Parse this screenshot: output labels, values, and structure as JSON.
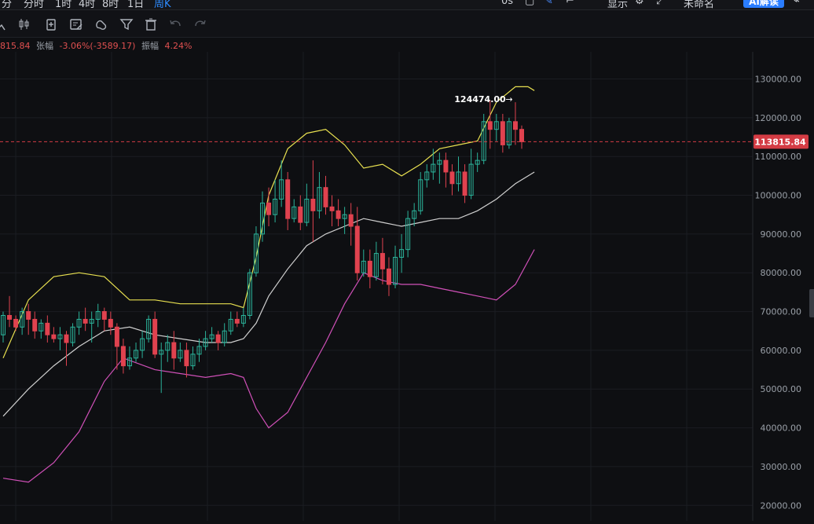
{
  "topbar": {
    "timeframes": [
      {
        "label": "分",
        "key": "min"
      },
      {
        "label": "分时",
        "key": "time"
      },
      {
        "label": "1时",
        "key": "1h"
      },
      {
        "label": "4时",
        "key": "4h"
      },
      {
        "label": "8时",
        "key": "8h"
      },
      {
        "label": "1日",
        "key": "1d"
      },
      {
        "label": "周K",
        "key": "1w",
        "active": true
      }
    ],
    "right_items": [
      "0s",
      "显示",
      "未命名"
    ],
    "ai_button": "AI解读"
  },
  "infoline": {
    "close_fragment": "815.84",
    "change_label": "张幅",
    "change_value": "-3.06%(-3589.17)",
    "amplitude_label": "振幅",
    "amplitude_value": "4.24%"
  },
  "colors": {
    "up": "#2bb39a",
    "down": "#e0424f",
    "upper_band": "#e8e050",
    "middle_band": "#d0d0d0",
    "lower_band": "#d050b8",
    "price_tag": "#d43c44"
  },
  "chart_data": {
    "type": "candlestick",
    "y_axis": {
      "ticks": [
        "130000.00",
        "120000.00",
        "110000.00",
        "100000.00",
        "90000.00",
        "80000.00",
        "70000.00",
        "60000.00",
        "50000.00",
        "40000.00",
        "30000.00",
        "20000.00"
      ],
      "ylim": [
        16000,
        137000
      ]
    },
    "last_price": "113815.84",
    "high_marker": "124474.00",
    "candles": [
      [
        64000,
        69000,
        62000,
        70000
      ],
      [
        69000,
        68000,
        66000,
        74000
      ],
      [
        68000,
        66000,
        65000,
        69000
      ],
      [
        66000,
        70000,
        64000,
        71000
      ],
      [
        70000,
        68000,
        64000,
        72000
      ],
      [
        68000,
        65000,
        63000,
        70000
      ],
      [
        65000,
        67000,
        63000,
        68000
      ],
      [
        67000,
        64000,
        62000,
        69000
      ],
      [
        64000,
        63000,
        62000,
        66000
      ],
      [
        63000,
        64000,
        60000,
        66000
      ],
      [
        64000,
        62000,
        56000,
        65000
      ],
      [
        62000,
        66000,
        61000,
        67000
      ],
      [
        66000,
        68000,
        64000,
        70000
      ],
      [
        68000,
        67000,
        65000,
        71000
      ],
      [
        67000,
        68000,
        62000,
        70000
      ],
      [
        68000,
        70000,
        66000,
        72000
      ],
      [
        70000,
        68000,
        65000,
        71000
      ],
      [
        68000,
        66000,
        64000,
        70000
      ],
      [
        66000,
        61000,
        55000,
        67000
      ],
      [
        61000,
        56000,
        54000,
        63000
      ],
      [
        56000,
        58000,
        55000,
        61000
      ],
      [
        58000,
        60000,
        57000,
        62000
      ],
      [
        60000,
        63000,
        58000,
        65000
      ],
      [
        63000,
        68000,
        62000,
        69000
      ],
      [
        68000,
        59000,
        58000,
        70000
      ],
      [
        59000,
        60000,
        49000,
        62000
      ],
      [
        60000,
        62000,
        57000,
        64000
      ],
      [
        62000,
        58000,
        55000,
        65000
      ],
      [
        58000,
        60000,
        57000,
        62000
      ],
      [
        60000,
        56000,
        53000,
        62000
      ],
      [
        56000,
        59000,
        55000,
        61000
      ],
      [
        59000,
        61000,
        57000,
        63000
      ],
      [
        61000,
        63000,
        60000,
        65000
      ],
      [
        63000,
        64000,
        62000,
        66000
      ],
      [
        64000,
        62000,
        60000,
        65000
      ],
      [
        62000,
        65000,
        61000,
        67000
      ],
      [
        65000,
        68000,
        64000,
        70000
      ],
      [
        68000,
        67000,
        66000,
        70000
      ],
      [
        67000,
        69000,
        66000,
        71000
      ],
      [
        69000,
        80000,
        68000,
        81000
      ],
      [
        80000,
        90000,
        79000,
        92000
      ],
      [
        90000,
        98000,
        88000,
        101000
      ],
      [
        98000,
        95000,
        92000,
        102000
      ],
      [
        95000,
        99000,
        93000,
        104000
      ],
      [
        99000,
        104000,
        97000,
        109000
      ],
      [
        104000,
        94000,
        91000,
        106000
      ],
      [
        94000,
        97000,
        93000,
        99000
      ],
      [
        97000,
        93000,
        91000,
        100000
      ],
      [
        93000,
        99000,
        92000,
        103000
      ],
      [
        99000,
        96000,
        88000,
        109000
      ],
      [
        96000,
        102000,
        94000,
        106000
      ],
      [
        102000,
        97000,
        95000,
        105000
      ],
      [
        97000,
        96000,
        92000,
        100000
      ],
      [
        96000,
        94000,
        92000,
        99000
      ],
      [
        94000,
        95000,
        90000,
        97000
      ],
      [
        95000,
        92000,
        87000,
        98000
      ],
      [
        92000,
        80000,
        78000,
        97000
      ],
      [
        80000,
        83000,
        79000,
        86000
      ],
      [
        83000,
        79000,
        76000,
        86000
      ],
      [
        79000,
        85000,
        78000,
        88000
      ],
      [
        85000,
        81000,
        77000,
        89000
      ],
      [
        81000,
        77000,
        74000,
        84000
      ],
      [
        77000,
        84000,
        76000,
        87000
      ],
      [
        84000,
        86000,
        80000,
        90000
      ],
      [
        86000,
        94000,
        84000,
        96000
      ],
      [
        94000,
        96000,
        92000,
        98000
      ],
      [
        96000,
        104000,
        95000,
        106000
      ],
      [
        104000,
        106000,
        102000,
        108000
      ],
      [
        106000,
        108000,
        104000,
        112000
      ],
      [
        108000,
        109000,
        103000,
        111000
      ],
      [
        109000,
        106000,
        102000,
        111000
      ],
      [
        106000,
        103000,
        100000,
        108000
      ],
      [
        103000,
        106000,
        101000,
        110000
      ],
      [
        106000,
        100000,
        98000,
        108000
      ],
      [
        100000,
        108000,
        99000,
        112000
      ],
      [
        108000,
        109000,
        106000,
        111000
      ],
      [
        109000,
        119000,
        108000,
        121000
      ],
      [
        119000,
        117000,
        112000,
        124474
      ],
      [
        117000,
        119000,
        114000,
        121000
      ],
      [
        119000,
        113000,
        111000,
        121000
      ],
      [
        113000,
        119000,
        112000,
        120000
      ],
      [
        119000,
        117000,
        113000,
        124000
      ],
      [
        117000,
        113816,
        112000,
        118000
      ]
    ],
    "upper_band": [
      [
        0,
        58000
      ],
      [
        4,
        73000
      ],
      [
        8,
        79000
      ],
      [
        12,
        80000
      ],
      [
        16,
        79000
      ],
      [
        20,
        73000
      ],
      [
        24,
        73000
      ],
      [
        28,
        72000
      ],
      [
        32,
        72000
      ],
      [
        36,
        72000
      ],
      [
        38,
        71000
      ],
      [
        40,
        84000
      ],
      [
        42,
        100000
      ],
      [
        45,
        112000
      ],
      [
        48,
        116000
      ],
      [
        51,
        117000
      ],
      [
        54,
        113000
      ],
      [
        57,
        107000
      ],
      [
        60,
        108000
      ],
      [
        63,
        105000
      ],
      [
        66,
        108000
      ],
      [
        69,
        112000
      ],
      [
        72,
        113000
      ],
      [
        75,
        114000
      ],
      [
        78,
        124000
      ],
      [
        81,
        128000
      ],
      [
        83,
        128000
      ],
      [
        84,
        127000
      ]
    ],
    "middle_band": [
      [
        0,
        43000
      ],
      [
        4,
        50000
      ],
      [
        8,
        56000
      ],
      [
        12,
        61000
      ],
      [
        16,
        65000
      ],
      [
        20,
        66000
      ],
      [
        24,
        64000
      ],
      [
        28,
        63000
      ],
      [
        32,
        62000
      ],
      [
        36,
        62000
      ],
      [
        38,
        63000
      ],
      [
        40,
        67000
      ],
      [
        42,
        74000
      ],
      [
        45,
        81000
      ],
      [
        48,
        87000
      ],
      [
        51,
        90000
      ],
      [
        54,
        92000
      ],
      [
        57,
        94000
      ],
      [
        60,
        93000
      ],
      [
        63,
        92000
      ],
      [
        66,
        93000
      ],
      [
        69,
        94000
      ],
      [
        72,
        94000
      ],
      [
        75,
        96000
      ],
      [
        78,
        99000
      ],
      [
        81,
        103000
      ],
      [
        84,
        106000
      ]
    ],
    "lower_band": [
      [
        0,
        27000
      ],
      [
        4,
        26000
      ],
      [
        8,
        31000
      ],
      [
        12,
        39000
      ],
      [
        16,
        52000
      ],
      [
        19,
        58000
      ],
      [
        24,
        55000
      ],
      [
        28,
        54000
      ],
      [
        32,
        53000
      ],
      [
        36,
        54000
      ],
      [
        38,
        53000
      ],
      [
        40,
        45000
      ],
      [
        42,
        40000
      ],
      [
        45,
        44000
      ],
      [
        48,
        53000
      ],
      [
        51,
        62000
      ],
      [
        54,
        72000
      ],
      [
        57,
        80000
      ],
      [
        60,
        78000
      ],
      [
        63,
        77000
      ],
      [
        66,
        77000
      ],
      [
        69,
        76000
      ],
      [
        72,
        75000
      ],
      [
        75,
        74000
      ],
      [
        78,
        73000
      ],
      [
        81,
        77000
      ],
      [
        84,
        86000
      ]
    ]
  }
}
